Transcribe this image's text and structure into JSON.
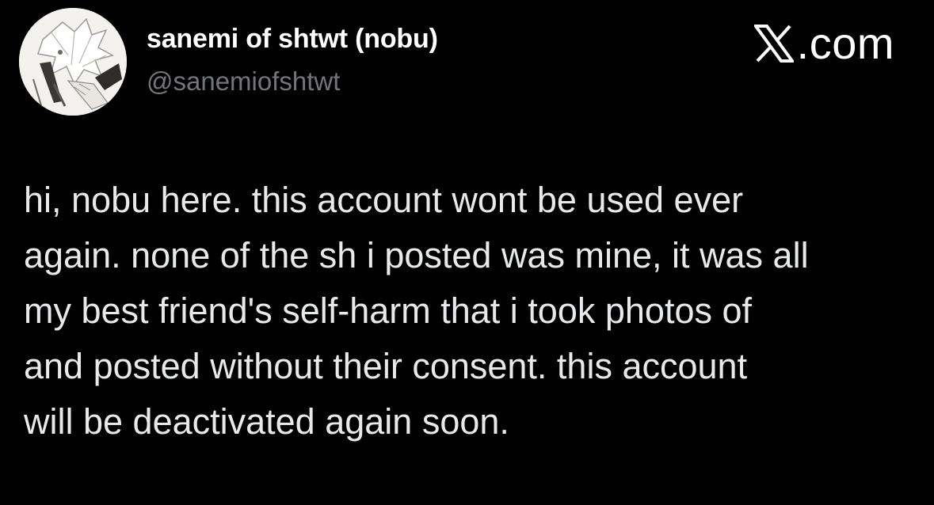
{
  "tweet": {
    "display_name": "sanemi of shtwt (nobu)",
    "handle": "@sanemiofshtwt",
    "avatar_icon": "profile-avatar",
    "brand": {
      "icon": "x-logo-icon",
      "text": ".com"
    },
    "body_lines": [
      "hi, nobu here. this account wont be used ever",
      "again. none of the sh i posted was mine, it was all",
      "my best friend's self-harm that i took photos of",
      "and posted without their consent. this account",
      "will be deactivated again soon."
    ]
  },
  "colors": {
    "background": "#000000",
    "name": "#ffffff",
    "handle": "#71767b",
    "body_text": "#e7e9ea"
  }
}
